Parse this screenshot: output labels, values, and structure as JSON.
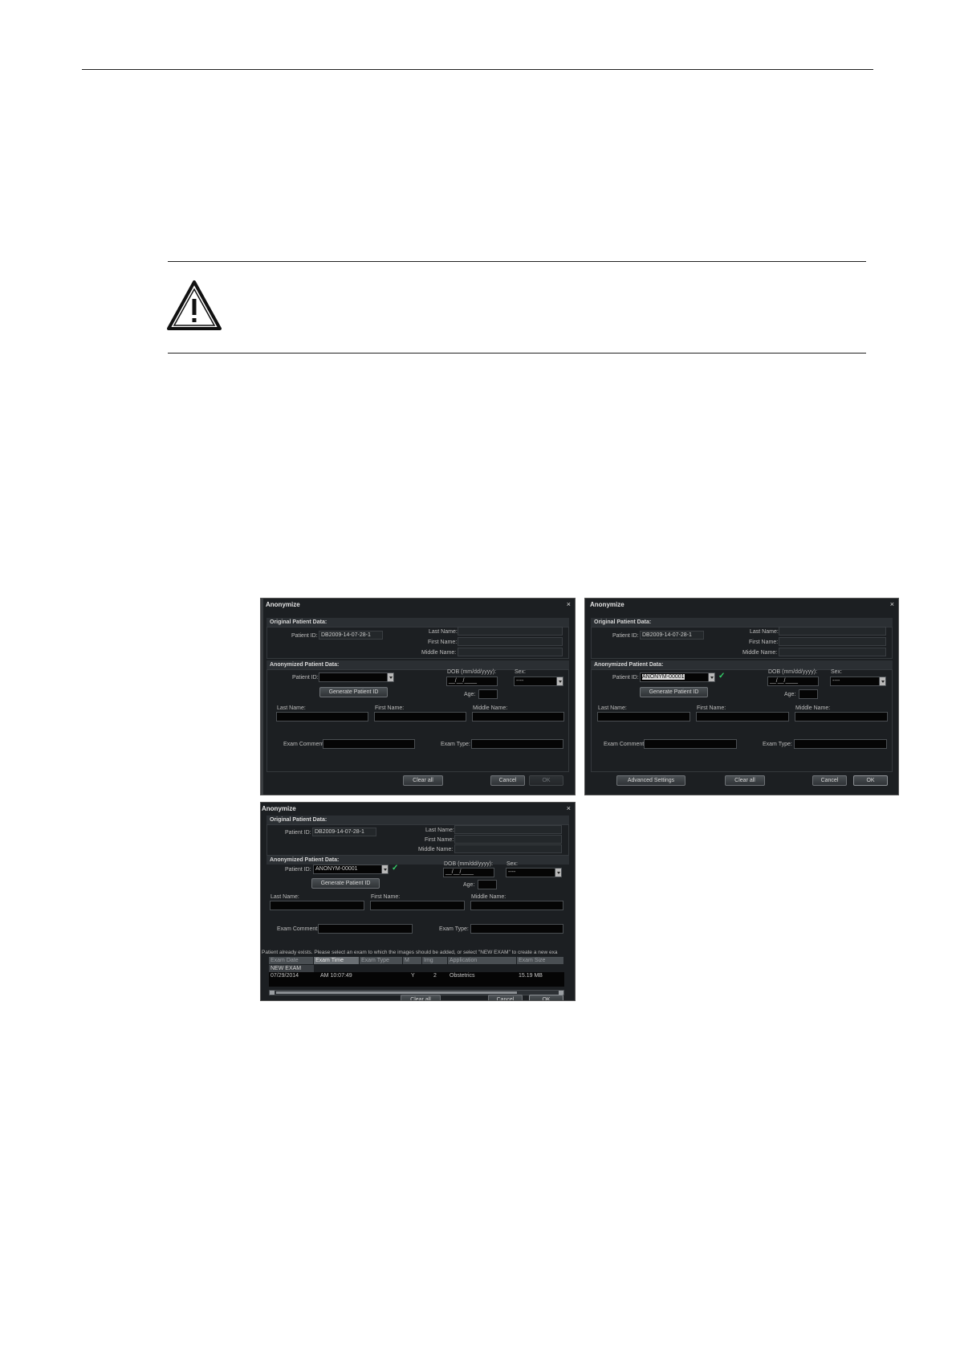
{
  "warning_icon": "warning-triangle-icon",
  "close_icon": "close-icon",
  "dropdown_icon": "chevron-down-icon",
  "check_icon": "checkmark-icon",
  "dialogs": {
    "d1": {
      "title": "Anonymize",
      "close": "×",
      "original_header": "Original Patient Data:",
      "orig_patient_id_label": "Patient ID:",
      "orig_patient_id": "DB2009-14-07-28-1",
      "orig_last_name_label": "Last Name:",
      "orig_first_name_label": "First Name:",
      "orig_middle_name_label": "Middle Name:",
      "anon_header": "Anonymized Patient Data:",
      "patient_id_label": "Patient ID:",
      "patient_id_value": "",
      "generate_button": "Generate Patient ID",
      "dob_label": "DOB (mm/dd/yyyy):",
      "dob_value": "__/__/____",
      "sex_label": "Sex:",
      "sex_value": "----",
      "age_label": "Age:",
      "last_name_label": "Last Name:",
      "first_name_label": "First Name:",
      "middle_name_label": "Middle Name:",
      "exam_comment_label": "Exam Comment:",
      "exam_type_label": "Exam Type:",
      "clear_all": "Clear all",
      "cancel": "Cancel",
      "ok": "OK"
    },
    "d2": {
      "title": "Anonymize",
      "close": "×",
      "original_header": "Original Patient Data:",
      "orig_patient_id_label": "Patient ID:",
      "orig_patient_id": "DB2009-14-07-28-1",
      "orig_last_name_label": "Last Name:",
      "orig_first_name_label": "First Name:",
      "orig_middle_name_label": "Middle Name:",
      "anon_header": "Anonymized Patient Data:",
      "patient_id_label": "Patient ID:",
      "patient_id_value": "ANONYM-00001",
      "check": "✓",
      "generate_button": "Generate Patient ID",
      "dob_label": "DOB (mm/dd/yyyy):",
      "dob_value": "__/__/____",
      "sex_label": "Sex:",
      "sex_value": "----",
      "age_label": "Age:",
      "last_name_label": "Last Name:",
      "first_name_label": "First Name:",
      "middle_name_label": "Middle Name:",
      "exam_comment_label": "Exam Comment:",
      "exam_type_label": "Exam Type:",
      "advanced_settings": "Advanced Settings",
      "clear_all": "Clear all",
      "cancel": "Cancel",
      "ok": "OK"
    },
    "d3": {
      "title": "Anonymize",
      "close": "×",
      "original_header": "Original Patient Data:",
      "orig_patient_id_label": "Patient ID:",
      "orig_patient_id": "DB2009-14-07-28-1",
      "orig_last_name_label": "Last Name:",
      "orig_first_name_label": "First Name:",
      "orig_middle_name_label": "Middle Name:",
      "anon_header": "Anonymized Patient Data:",
      "patient_id_label": "Patient ID:",
      "patient_id_value": "ANONYM-00001",
      "check": "✓",
      "generate_button": "Generate Patient ID",
      "dob_label": "DOB (mm/dd/yyyy):",
      "dob_value": "__/__/____",
      "sex_label": "Sex:",
      "sex_value": "----",
      "age_label": "Age:",
      "last_name_label": "Last Name:",
      "first_name_label": "First Name:",
      "middle_name_label": "Middle Name:",
      "exam_comment_label": "Exam Comment:",
      "exam_type_label": "Exam Type:",
      "exists_message": "Patient already exists. Please select an exam to which the images should be added, or select \"NEW EXAM\" to create a new exa",
      "table": {
        "headers": [
          "Exam Date",
          "Exam Time",
          "Exam Type",
          "M",
          "Img",
          "Application",
          "Exam Size"
        ],
        "new_exam": "NEW EXAM",
        "row": [
          "07/29/2014",
          "AM 10:07:49",
          "",
          "Y",
          "2",
          "Obstetrics",
          "15.19 MB"
        ]
      },
      "clear_all": "Clear all",
      "cancel": "Cancel",
      "ok": "OK"
    }
  }
}
